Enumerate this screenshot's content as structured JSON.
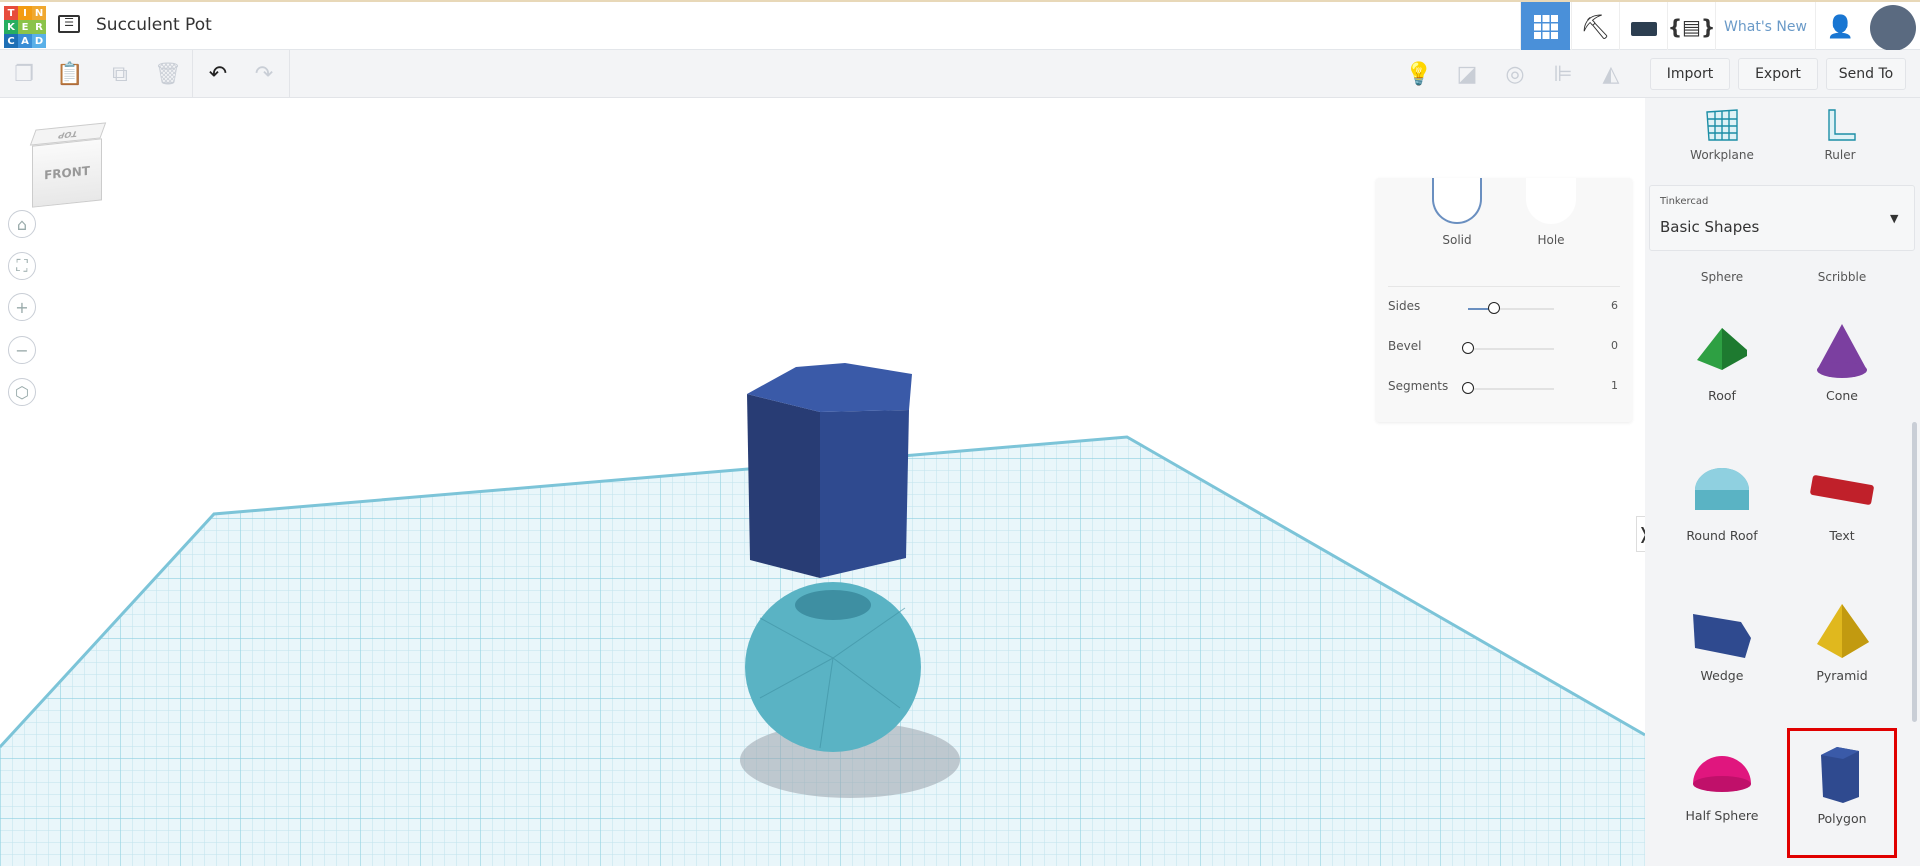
{
  "header": {
    "logo_letters": [
      "T",
      "I",
      "N",
      "K",
      "E",
      "R",
      "C",
      "A",
      "D"
    ],
    "title": "Succulent Pot",
    "whats_new": "What's New"
  },
  "toolbar": {
    "import": "Import",
    "export": "Export",
    "send_to": "Send To"
  },
  "viewcube": {
    "front": "FRONT",
    "top": "TOP"
  },
  "inspector": {
    "solid": "Solid",
    "hole": "Hole",
    "params": [
      {
        "label": "Sides",
        "value": "6",
        "fraction": 0.3
      },
      {
        "label": "Bevel",
        "value": "0",
        "fraction": 0
      },
      {
        "label": "Segments",
        "value": "1",
        "fraction": 0
      }
    ]
  },
  "panel": {
    "workplane": "Workplane",
    "ruler": "Ruler",
    "dropdown_caption": "Tinkercad",
    "dropdown_value": "Basic Shapes",
    "shapes": [
      {
        "name": "Sphere"
      },
      {
        "name": "Scribble"
      },
      {
        "name": "Roof"
      },
      {
        "name": "Cone"
      },
      {
        "name": "Round Roof"
      },
      {
        "name": "Text"
      },
      {
        "name": "Wedge"
      },
      {
        "name": "Pyramid"
      },
      {
        "name": "Half Sphere"
      },
      {
        "name": "Polygon",
        "selected": true
      }
    ]
  },
  "colors": {
    "accent": "#4a90d9",
    "selected_outline": "#e00000",
    "grid": "#8fd0e0",
    "polygon": "#2f4a8f",
    "sphere": "#5ab3c4"
  }
}
